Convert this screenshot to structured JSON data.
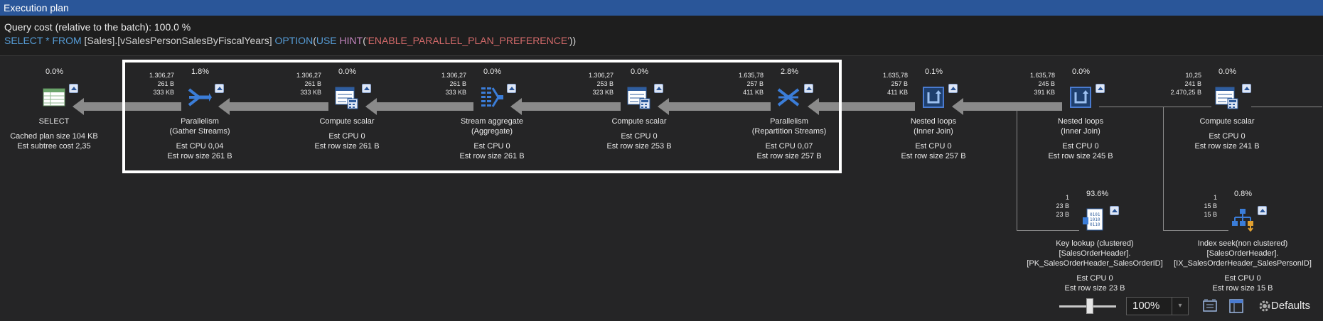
{
  "window": {
    "title": "Execution plan"
  },
  "header": {
    "cost": "Query cost (relative to the batch):  100.0 %",
    "sql": [
      {
        "t": "SELECT",
        "c": "kw"
      },
      {
        "t": " * ",
        "c": "kw"
      },
      {
        "t": "FROM",
        "c": "kw"
      },
      {
        "t": " [Sales].[vSalesPersonSalesByFiscalYears] ",
        "c": "id"
      },
      {
        "t": "OPTION",
        "c": "kw"
      },
      {
        "t": "(",
        "c": "id"
      },
      {
        "t": "USE",
        "c": "kw"
      },
      {
        "t": " ",
        "c": "id"
      },
      {
        "t": "HINT",
        "c": "fn"
      },
      {
        "t": "(",
        "c": "id"
      },
      {
        "t": "'ENABLE_PARALLEL_PLAN_PREFERENCE'",
        "c": "str"
      },
      {
        "t": "))",
        "c": "id"
      }
    ]
  },
  "nodes": [
    {
      "id": "select",
      "pct": "0.0%",
      "stats": [],
      "icon": "select-icon",
      "lines": [
        "SELECT"
      ],
      "est": [
        "Cached plan size  104 KB",
        "Est subtree cost  2,35"
      ]
    },
    {
      "id": "parallelism-gather",
      "pct": "1.8%",
      "stats": [
        "1.306,27",
        "261 B",
        "333 KB"
      ],
      "icon": "parallelism-gather-icon",
      "lines": [
        "Parallelism",
        "(Gather Streams)"
      ],
      "est": [
        "Est CPU  0,04",
        "Est row size  261 B"
      ]
    },
    {
      "id": "compute-scalar-1",
      "pct": "0.0%",
      "stats": [
        "1.306,27",
        "261 B",
        "333 KB"
      ],
      "icon": "compute-scalar-icon",
      "lines": [
        "Compute scalar"
      ],
      "est": [
        "Est CPU  0",
        "Est row size  261 B"
      ]
    },
    {
      "id": "stream-aggregate",
      "pct": "0.0%",
      "stats": [
        "1.306,27",
        "261 B",
        "333 KB"
      ],
      "icon": "stream-aggregate-icon",
      "lines": [
        "Stream aggregate",
        "(Aggregate)"
      ],
      "est": [
        "Est CPU  0",
        "Est row size  261 B"
      ]
    },
    {
      "id": "compute-scalar-2",
      "pct": "0.0%",
      "stats": [
        "1.306,27",
        "253 B",
        "323 KB"
      ],
      "icon": "compute-scalar-icon",
      "lines": [
        "Compute scalar"
      ],
      "est": [
        "Est CPU  0",
        "Est row size  253 B"
      ]
    },
    {
      "id": "parallelism-repartition",
      "pct": "2.8%",
      "stats": [
        "1.635,78",
        "257 B",
        "411 KB"
      ],
      "icon": "parallelism-repartition-icon",
      "lines": [
        "Parallelism",
        "(Repartition Streams)"
      ],
      "est": [
        "Est CPU  0,07",
        "Est row size  257 B"
      ]
    },
    {
      "id": "nested-loops-1",
      "pct": "0.1%",
      "stats": [
        "1.635,78",
        "257 B",
        "411 KB"
      ],
      "icon": "nested-loops-icon",
      "lines": [
        "Nested loops",
        "(Inner Join)"
      ],
      "est": [
        "Est CPU  0",
        "Est row size  257 B"
      ]
    },
    {
      "id": "nested-loops-2",
      "pct": "0.0%",
      "stats": [
        "1.635,78",
        "245 B",
        "391 KB"
      ],
      "icon": "nested-loops-icon",
      "lines": [
        "Nested loops",
        "(Inner Join)"
      ],
      "est": [
        "Est CPU  0",
        "Est row size  245 B"
      ]
    },
    {
      "id": "compute-scalar-3",
      "pct": "0.0%",
      "stats": [
        "10,25",
        "241 B",
        "2.470,25 B"
      ],
      "icon": "compute-scalar-icon",
      "lines": [
        "Compute scalar"
      ],
      "est": [
        "Est CPU  0",
        "Est row size  241 B"
      ]
    },
    {
      "id": "key-lookup",
      "pct": "93.6%",
      "stats": [
        "1",
        "23 B",
        "23 B"
      ],
      "icon": "key-lookup-icon",
      "lines": [
        "Key lookup (clustered)",
        "[SalesOrderHeader].",
        "[PK_SalesOrderHeader_SalesOrderID]"
      ],
      "est": [
        "Est CPU  0",
        "Est row size  23 B"
      ]
    },
    {
      "id": "index-seek",
      "pct": "0.8%",
      "stats": [
        "1",
        "15 B",
        "15 B"
      ],
      "icon": "index-seek-icon",
      "lines": [
        "Index seek(non clustered)",
        "[SalesOrderHeader].",
        "[IX_SalesOrderHeader_SalesPersonID]"
      ],
      "est": [
        "Est CPU  0",
        "Est row size  15 B"
      ]
    }
  ],
  "footer": {
    "zoom": "100%",
    "defaults": "Defaults"
  }
}
